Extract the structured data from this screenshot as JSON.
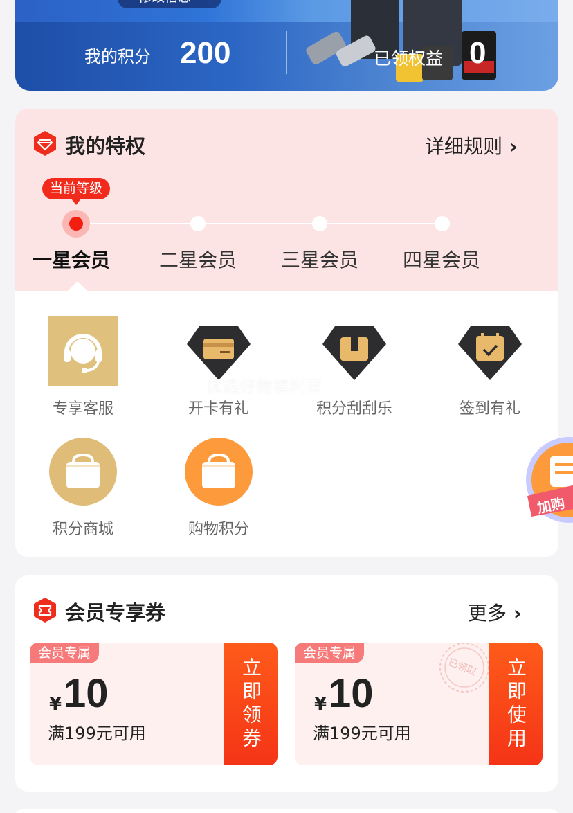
{
  "banner": {
    "edit_info": "修改信息 ›",
    "points_label": "我的积分",
    "points_value": "200",
    "benefit_label": "已领权益",
    "benefit_value": "0"
  },
  "privileges": {
    "title": "我的特权",
    "rules_link": "详细规则",
    "chevron": "›",
    "current_level_badge": "当前等级",
    "levels": [
      "一星会员",
      "二星会员",
      "三星会员",
      "四星会员"
    ],
    "current_level_index": 0,
    "watermark": "优选好物福利官",
    "items": [
      {
        "label": "专享客服",
        "icon": "headset-icon"
      },
      {
        "label": "开卡有礼",
        "icon": "card-icon"
      },
      {
        "label": "积分刮刮乐",
        "icon": "gift-box-icon"
      },
      {
        "label": "签到有礼",
        "icon": "calendar-check-icon"
      },
      {
        "label": "积分商城",
        "icon": "shopping-bag-icon"
      },
      {
        "label": "购物积分",
        "icon": "shopping-bag-icon"
      }
    ],
    "float_cart_label": "加购"
  },
  "coupons": {
    "title": "会员专享券",
    "more_link": "更多",
    "chevron": "›",
    "items": [
      {
        "tag": "会员专属",
        "currency": "¥",
        "amount": "10",
        "condition": "满199元可用",
        "action": "立即领券",
        "claimed": false
      },
      {
        "tag": "会员专属",
        "currency": "¥",
        "amount": "10",
        "condition": "满199元可用",
        "action": "立即使用",
        "claimed": true,
        "stamp": "已领取"
      }
    ]
  },
  "colors": {
    "accent_red": "#f22a1c",
    "header_pink": "#fde4e4",
    "gold": "#dfc07c",
    "orange": "#fd9a3c",
    "banner_blue": "#2c61c5"
  }
}
